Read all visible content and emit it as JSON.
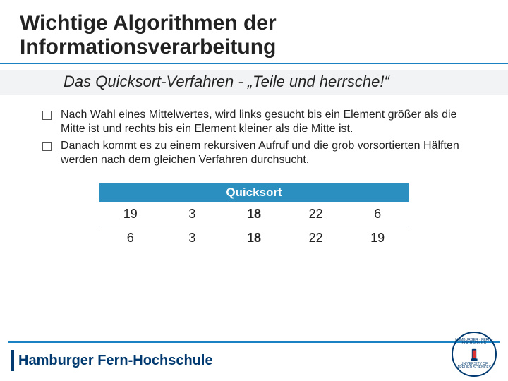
{
  "title": "Wichtige Algorithmen der Informationsverarbeitung",
  "subtitle": "Das Quicksort-Verfahren - „Teile und herrsche!“",
  "bullets": [
    "Nach Wahl eines Mittelwertes, wird links gesucht bis ein Element größer als die Mitte ist und rechts bis ein Element kleiner als die Mitte ist.",
    "Danach kommt es zu einem rekursiven Aufruf und die grob vorsortierten Hälften werden nach dem gleichen Verfahren durchsucht."
  ],
  "table": {
    "header": "Quicksort",
    "rows": [
      [
        {
          "v": "19",
          "style": "u"
        },
        {
          "v": "3",
          "style": ""
        },
        {
          "v": "18",
          "style": "b"
        },
        {
          "v": "22",
          "style": ""
        },
        {
          "v": "6",
          "style": "u"
        }
      ],
      [
        {
          "v": "6",
          "style": ""
        },
        {
          "v": "3",
          "style": ""
        },
        {
          "v": "18",
          "style": "b"
        },
        {
          "v": "22",
          "style": ""
        },
        {
          "v": "19",
          "style": ""
        }
      ]
    ]
  },
  "footer": {
    "brand": "Hamburger Fern-Hochschule",
    "seal_top": "HAMBURGER · FERN · HOCHSCHULE",
    "seal_bottom": "UNIVERSITY OF APPLIED SCIENCES"
  },
  "colors": {
    "accent": "#1a81c3",
    "brand": "#003a70",
    "table_head": "#2b8fbf"
  }
}
